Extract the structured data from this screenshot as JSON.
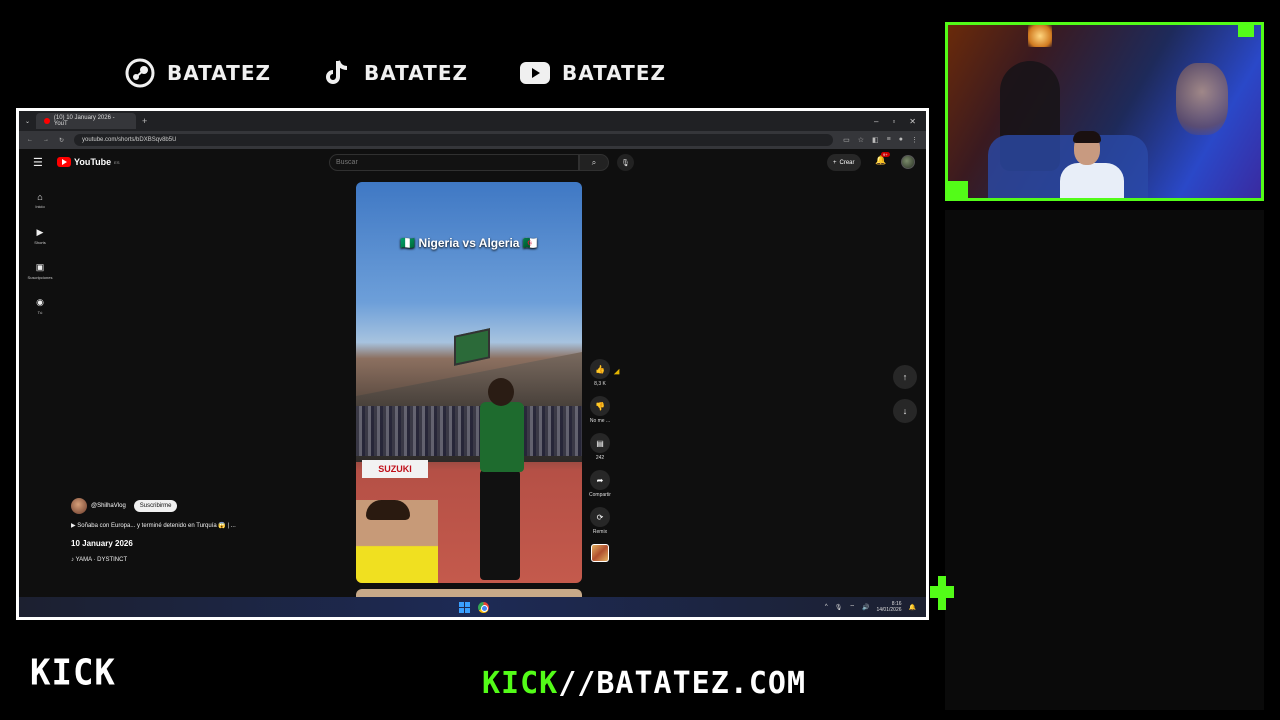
{
  "overlay": {
    "socials": [
      {
        "platform": "steam-icon",
        "name": "BATATEZ"
      },
      {
        "platform": "tiktok-icon",
        "name": "BATATEZ"
      },
      {
        "platform": "youtube-icon",
        "name": "BATATEZ"
      }
    ],
    "kick_logo": "KICK",
    "kick_url_prefix": "KICK",
    "kick_url_rest": "//BATATEZ.COM",
    "accent_color": "#53fc18"
  },
  "browser": {
    "tab_title": "(10) 10 January 2026 - YouT",
    "url": "youtube.com/shorts/bDXBSqv8b5U"
  },
  "youtube": {
    "logo": "YouTube",
    "logo_country": "ES",
    "search_placeholder": "Buscar",
    "create_label": "Crear",
    "notifications_badge": "9+",
    "sidenav": [
      {
        "icon": "home-icon",
        "label": "Inicio"
      },
      {
        "icon": "shorts-icon",
        "label": "Shorts"
      },
      {
        "icon": "subscriptions-icon",
        "label": "Suscripciones"
      },
      {
        "icon": "you-icon",
        "label": "Tú"
      }
    ],
    "short": {
      "caption": "🇳🇬 Nigeria vs Algeria 🇩🇿",
      "ad_board": "SUZUKI",
      "channel": "@ShilhaVlog",
      "subscribe_label": "Suscribirme",
      "title": "Soñaba con Europa... y terminé detenido en Turquía 😱 | ...",
      "date": "10 January 2026",
      "sound": "YAMA · DYSTINCT",
      "actions": {
        "likes": "8,3 K",
        "dislike": "No me ...",
        "comments": "242",
        "share": "Compartir",
        "remix": "Remix"
      }
    }
  },
  "taskbar": {
    "time": "8:16",
    "date": "14/01/2026"
  }
}
